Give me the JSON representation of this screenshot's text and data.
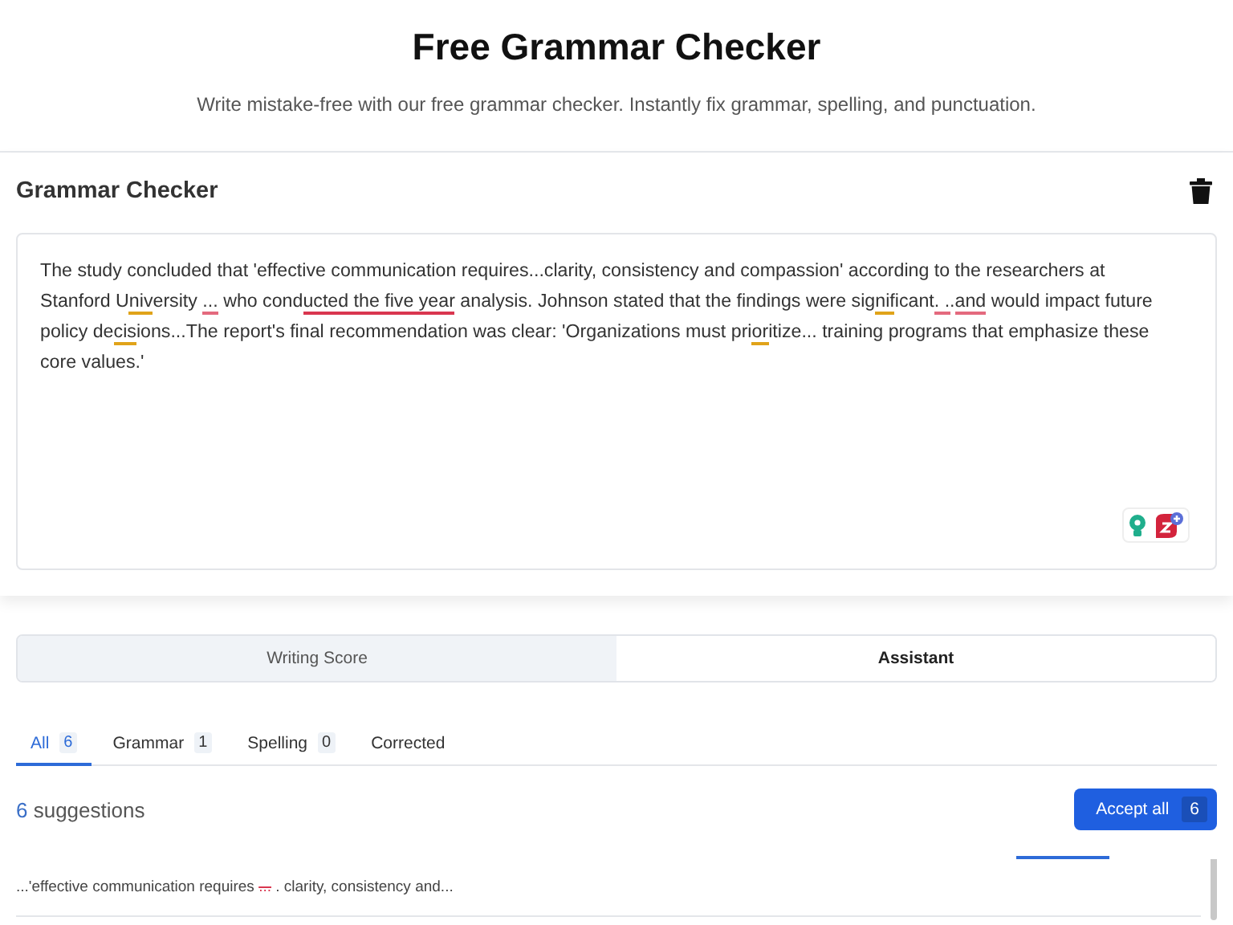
{
  "header": {
    "title": "Free Grammar Checker",
    "subtitle": "Write mistake-free with our free grammar checker. Instantly fix grammar, spelling, and punctuation."
  },
  "checker": {
    "title": "Grammar Checker",
    "segments": [
      {
        "text": "The study concluded that 'effective communication requires...clarity, consistency and compassion' according to the researchers at Stanford U"
      },
      {
        "text": "niv",
        "color": "#e0a31a"
      },
      {
        "text": "ersity "
      },
      {
        "text": "...",
        "color": "#e46a7e"
      },
      {
        "text": " who cond"
      },
      {
        "text": "ucted the five year",
        "color": "#d9364f"
      },
      {
        "text": " analysis. Johnson stated that the findings were sig"
      },
      {
        "text": "nif",
        "color": "#e0a31a"
      },
      {
        "text": "icant"
      },
      {
        "text": ". .",
        "color": "#e46a7e"
      },
      {
        "text": "."
      },
      {
        "text": "and",
        "color": "#e46a7e"
      },
      {
        "text": " would impact future policy de"
      },
      {
        "text": "cis",
        "color": "#e0a31a"
      },
      {
        "text": "ions...The report's final recommendation was clear: 'Organizations must pri"
      },
      {
        "text": "or",
        "color": "#e0a31a"
      },
      {
        "text": "itize... training programs that emphasize these core values.'"
      }
    ]
  },
  "view_tabs": [
    {
      "label": "Writing Score",
      "selected": false
    },
    {
      "label": "Assistant",
      "selected": true
    }
  ],
  "filter_tabs": [
    {
      "label": "All",
      "count": "6",
      "selected": true
    },
    {
      "label": "Grammar",
      "count": "1",
      "selected": false
    },
    {
      "label": "Spelling",
      "count": "0",
      "selected": false
    },
    {
      "label": "Corrected",
      "selected": false
    }
  ],
  "summary": {
    "count": "6",
    "label": "suggestions"
  },
  "accept_button": {
    "label": "Accept all",
    "count": "6"
  },
  "suggestions": [
    {
      "before": "...'effective communication requires ",
      "removed": "...",
      "after": " . clarity, consistency and..."
    }
  ]
}
